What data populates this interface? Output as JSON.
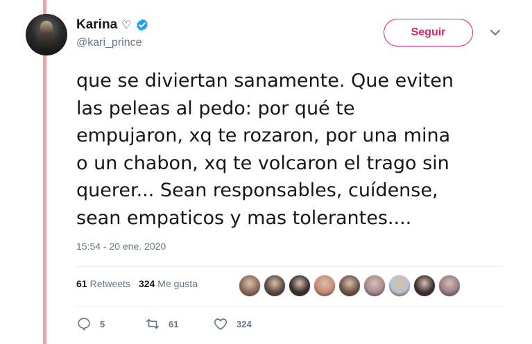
{
  "header": {
    "display_name": "Karina",
    "handle": "@kari_prince",
    "heart_glyph": "♡",
    "follow_label": "Seguir"
  },
  "tweet": {
    "lines": [
      "que se diviertan sanamente. Que eviten",
      "las peleas al pedo: por qué te",
      "empujaron, xq te rozaron, por una mina",
      "o un chabon, xq te volcaron el trago sin",
      "querer... Sean responsables, cuídense,",
      "sean empaticos y mas tolerantes...."
    ],
    "timestamp": "15:54 - 20 ene. 2020"
  },
  "stats": {
    "retweets_count": "61",
    "retweets_label": "Retweets",
    "likes_count": "324",
    "likes_label": "Me gusta",
    "liker_avatar_colors": [
      "#8a6a5a",
      "#5c4a3e",
      "#3a2e2e",
      "#c98b72",
      "#6e5448",
      "#a88a90",
      "#b8c2cc",
      "#3d3030",
      "#9a7c86"
    ]
  },
  "actions": {
    "replies": "5",
    "retweets": "61",
    "likes": "324"
  },
  "colors": {
    "accent": "#e0245e",
    "verified": "#1da1f2",
    "muted": "#657786",
    "thread_line": "#e8a7a7"
  }
}
